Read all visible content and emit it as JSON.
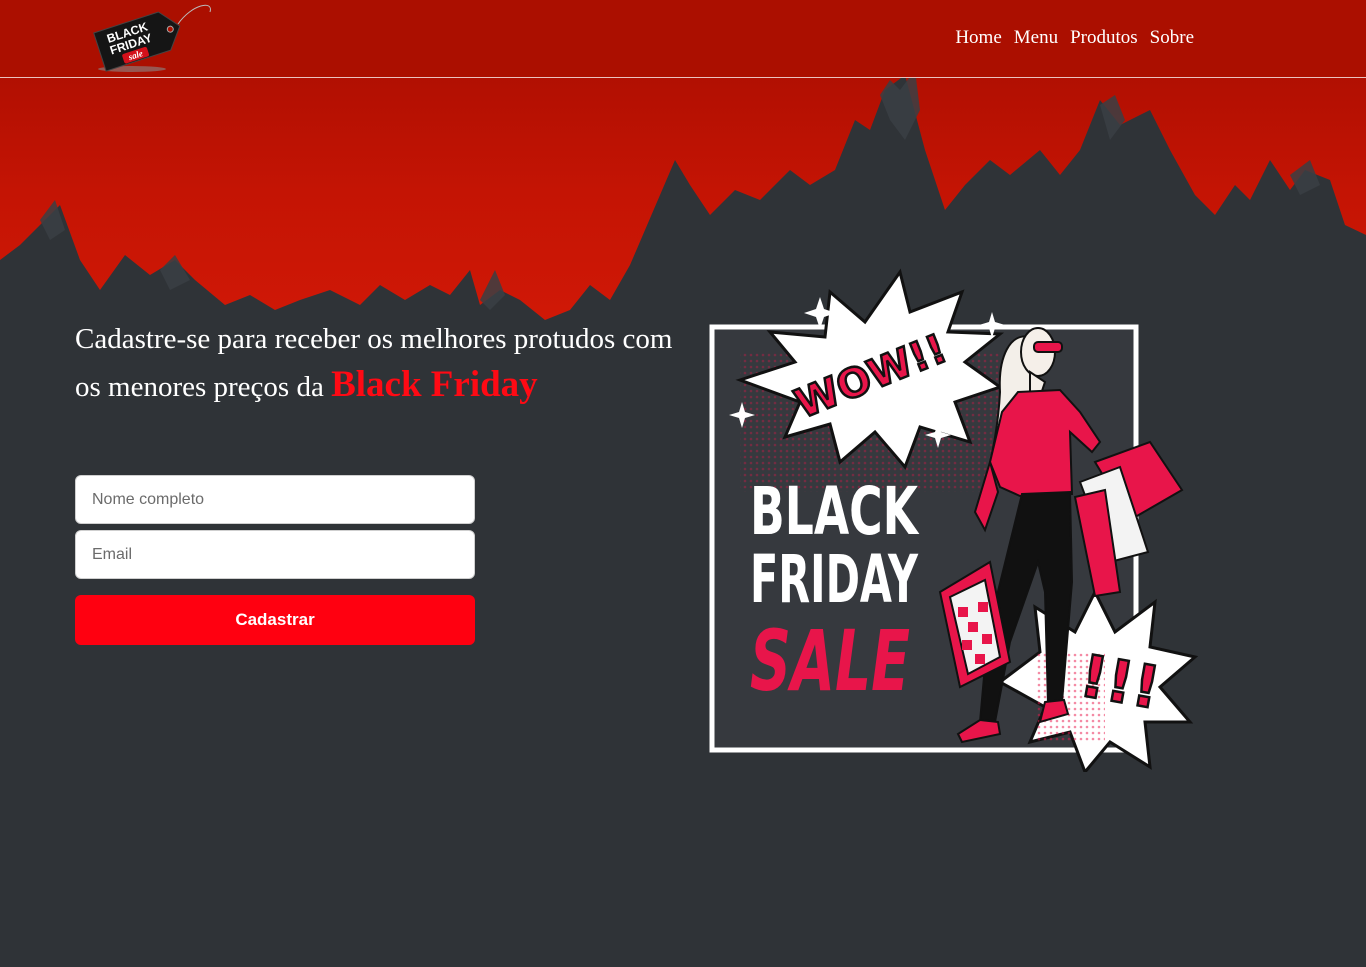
{
  "colors": {
    "accent": "#ff0010",
    "header_red": "#b01005",
    "background": "#2f3337"
  },
  "logo": {
    "line1": "BLACK",
    "line2": "FRIDAY",
    "line3": "sale"
  },
  "nav": {
    "items": [
      {
        "label": "Home"
      },
      {
        "label": "Menu"
      },
      {
        "label": "Produtos"
      },
      {
        "label": "Sobre"
      }
    ]
  },
  "hero": {
    "headline_text": "Cadastre-se para receber os melhores protudos com os menores preços da ",
    "headline_highlight": "Black Friday"
  },
  "form": {
    "name_placeholder": "Nome completo",
    "email_placeholder": "Email",
    "name_value": "",
    "email_value": "",
    "submit_label": "Cadastrar"
  },
  "promo": {
    "burst_text": "WOW!!",
    "line1": "BLACK",
    "line2": "FRIDAY",
    "line3": "SALE",
    "burst2_text": "!!!"
  }
}
